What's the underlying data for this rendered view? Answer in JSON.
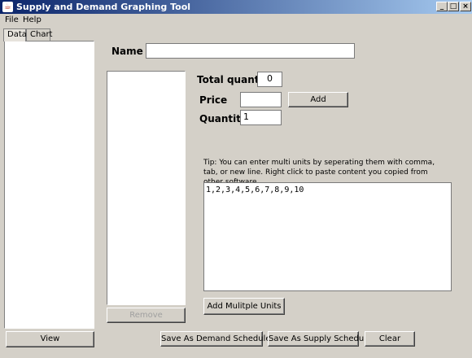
{
  "window": {
    "title": "Supply and Demand Graphing Tool",
    "minimize_glyph": "_",
    "maximize_glyph": "□",
    "close_glyph": "×",
    "app_icon": "java-cup-icon",
    "app_icon_glyph": "☕"
  },
  "menu": {
    "items": [
      "File",
      "Help"
    ]
  },
  "tabs": [
    {
      "label": "Data",
      "active": true
    },
    {
      "label": "Chart",
      "active": false
    }
  ],
  "sidebar": {
    "view_button": "View"
  },
  "form": {
    "name_label": "Name",
    "name_value": "",
    "total_quantity_label": "Total quantity",
    "total_quantity_value": "0",
    "price_label": "Price",
    "price_value": "",
    "add_button": "Add",
    "quantity_label": "Quantity",
    "quantity_value": "1",
    "remove_button": "Remove",
    "tip": "Tip: You can enter multi units by seperating them with comma, tab, or new line. Right click to paste content you copied from other software.",
    "units_value": "1,2,3,4,5,6,7,8,9,10",
    "add_multiple_button": "Add Mulitple Units"
  },
  "footer": {
    "save_demand": "Save As Demand Schedule",
    "save_supply": "Save As Supply Schedule",
    "clear": "Clear"
  },
  "colors": {
    "titlebar_start": "#0a246a",
    "titlebar_end": "#a6caf0",
    "face": "#d4d0c8"
  }
}
